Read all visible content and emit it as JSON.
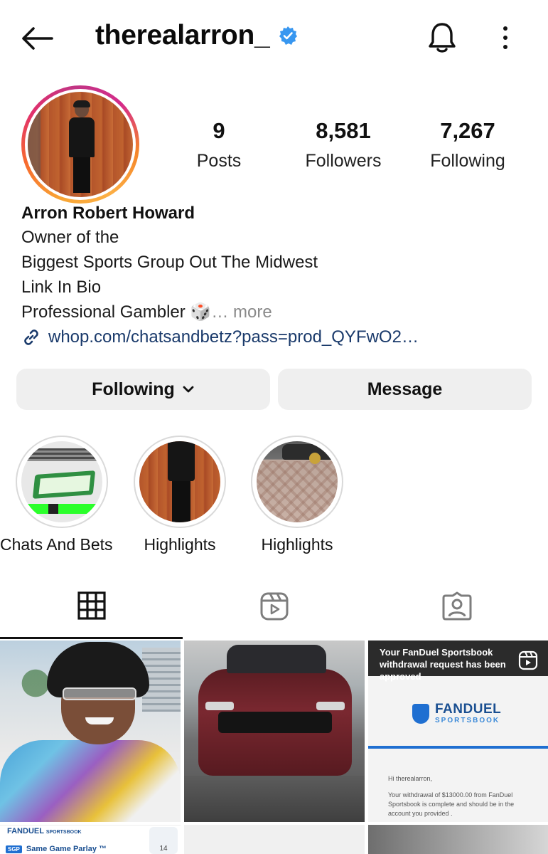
{
  "header": {
    "username": "therealarron_",
    "verified": true,
    "accent_color": "#3897f0"
  },
  "stats": {
    "posts": {
      "value": "9",
      "label": "Posts"
    },
    "followers": {
      "value": "8,581",
      "label": "Followers"
    },
    "following": {
      "value": "7,267",
      "label": "Following"
    }
  },
  "bio": {
    "name": "Arron Robert Howard",
    "lines": [
      "Owner of the",
      "Biggest Sports Group Out The Midwest",
      "Link In Bio"
    ],
    "last_line": "Professional Gambler 🎲",
    "more_label": "… more",
    "link": "whop.com/chatsandbetz?pass=prod_QYFwO2…",
    "link_color": "#1a3a6b"
  },
  "actions": {
    "following_label": "Following",
    "message_label": "Message"
  },
  "highlights": [
    {
      "label": "Chats And Bets"
    },
    {
      "label": "Highlights"
    },
    {
      "label": "Highlights"
    }
  ],
  "grid": {
    "post3": {
      "header_text": "Your FanDuel Sportsbook withdrawal request has been approved",
      "brand": "FANDUEL",
      "brand_sub": "SPORTSBOOK",
      "greeting": "Hi therealarron,",
      "body": "Your withdrawal of $13000.00 from FanDuel Sportsbook is complete and should be in the account you provided ."
    },
    "post4": {
      "brand": "FANDUEL",
      "brand_sub": "SPORTSBOOK",
      "badge": "SGP",
      "sgp_label": "Same Game Parlay ™",
      "count": "14"
    }
  }
}
